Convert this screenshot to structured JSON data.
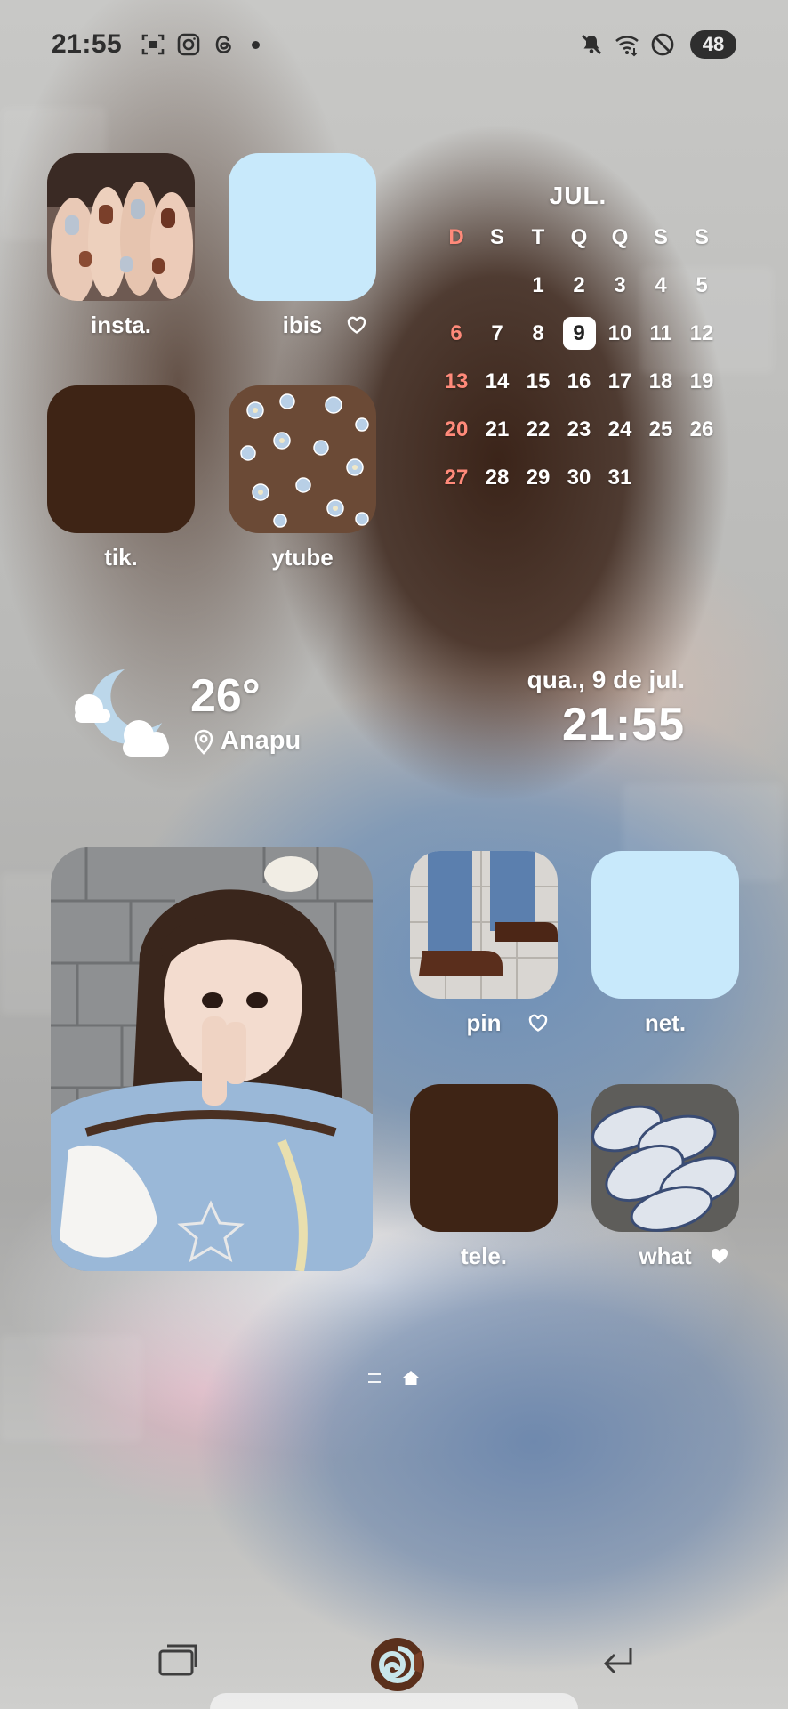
{
  "status_bar": {
    "time": "21:55",
    "left_icons": [
      "screenshot-icon",
      "instagram-icon",
      "threads-icon",
      "notification-dot"
    ],
    "right_icons": [
      "mute-icon",
      "wifi-icon",
      "do-not-disturb-icon"
    ],
    "battery": "48"
  },
  "apps_top": [
    {
      "label": "insta.",
      "tile": "photo-hands-nails",
      "heart": false
    },
    {
      "label": "ibis",
      "tile_color": "#c8e9fb",
      "heart": true
    },
    {
      "label": "tik.",
      "tile_color": "#3e2415",
      "heart": false
    },
    {
      "label": "ytube",
      "tile": "photo-floral-fabric",
      "heart": false
    }
  ],
  "calendar": {
    "month": "JUL.",
    "weekdays": [
      "D",
      "S",
      "T",
      "Q",
      "Q",
      "S",
      "S"
    ],
    "weeks": [
      [
        "",
        "",
        "1",
        "2",
        "3",
        "4",
        "5"
      ],
      [
        "6",
        "7",
        "8",
        "9",
        "10",
        "11",
        "12"
      ],
      [
        "13",
        "14",
        "15",
        "16",
        "17",
        "18",
        "19"
      ],
      [
        "20",
        "21",
        "22",
        "23",
        "24",
        "25",
        "26"
      ],
      [
        "27",
        "28",
        "29",
        "30",
        "31",
        "",
        ""
      ]
    ],
    "today": "9",
    "sunday_color": "#ff8a7a"
  },
  "weather": {
    "temperature": "26°",
    "location": "Anapu",
    "icon": "moon-cloud-icon"
  },
  "date_clock": {
    "date": "qua., 9 de jul.",
    "time": "21:55"
  },
  "apps_bottom": [
    {
      "label": "pin",
      "tile": "photo-shoes",
      "heart": true
    },
    {
      "label": "net.",
      "tile_color": "#c8e9fb",
      "heart": false
    },
    {
      "label": "tele.",
      "tile_color": "#3e2415",
      "heart": false
    },
    {
      "label": "what",
      "tile": "photo-plates",
      "heart": true
    }
  ],
  "photo_widget": {
    "image": "photo-girl-peace-sign"
  },
  "nav_bar": {
    "recents": "recents-icon",
    "home": "home-swiss-roll-icon",
    "back": "back-icon"
  }
}
